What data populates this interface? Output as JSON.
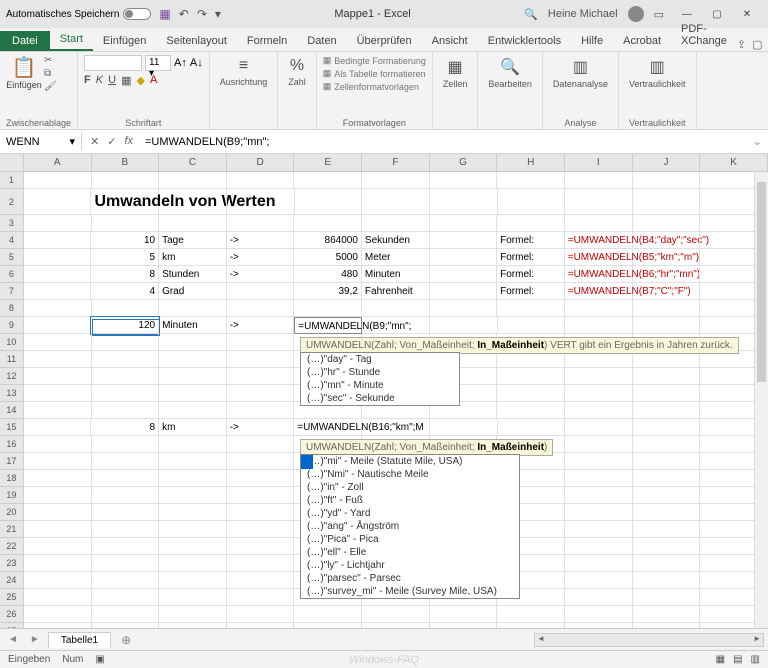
{
  "titlebar": {
    "autosave": "Automatisches Speichern",
    "doc_title": "Mappe1 - Excel",
    "user": "Heine Michael"
  },
  "tabs": {
    "file": "Datei",
    "home": "Start",
    "insert": "Einfügen",
    "pagelayout": "Seitenlayout",
    "formulas": "Formeln",
    "data": "Daten",
    "review": "Überprüfen",
    "view": "Ansicht",
    "developer": "Entwicklertools",
    "help": "Hilfe",
    "acrobat": "Acrobat",
    "pdfx": "PDF-XChange"
  },
  "ribbon": {
    "paste": "Einfügen",
    "clipboard": "Zwischenablage",
    "font": "Schriftart",
    "alignment": "Ausrichtung",
    "number": "Zahl",
    "condfmt": "Bedingte Formatierung",
    "astable": "Als Tabelle formatieren",
    "cellstyles": "Zellenformatvorlagen",
    "styles": "Formatvorlagen",
    "cells": "Zellen",
    "editing": "Bearbeiten",
    "analysis_btn": "Datenanalyse",
    "analysis": "Analyse",
    "sensitivity_btn": "Vertraulichkeit",
    "sensitivity": "Vertraulichkeit"
  },
  "namebox": "WENN",
  "formula_bar": "=UMWANDELN(B9;\"mn\";",
  "sheet": {
    "cols": [
      "A",
      "B",
      "C",
      "D",
      "E",
      "F",
      "G",
      "H",
      "I",
      "J",
      "K"
    ],
    "heading": "Umwandeln von Werten",
    "r4": {
      "b": "10",
      "c": "Tage",
      "d": "->",
      "e": "864000",
      "f": "Sekunden",
      "h": "Formel:",
      "i": "=UMWANDELN(B4;\"day\";\"sec\")"
    },
    "r5": {
      "b": "5",
      "c": "km",
      "d": "->",
      "e": "5000",
      "f": "Meter",
      "h": "Formel:",
      "i": "=UMWANDELN(B5;\"km\";\"m\")"
    },
    "r6": {
      "b": "8",
      "c": "Stunden",
      "d": "->",
      "e": "480",
      "f": "Minuten",
      "h": "Formel:",
      "i": "=UMWANDELN(B6;\"hr\";\"mn\")"
    },
    "r7": {
      "b": "4",
      "c": "Grad",
      "e": "39,2",
      "f": "Fahrenheit",
      "h": "Formel:",
      "i": "=UMWANDELN(B7;\"C\";\"F\")"
    },
    "r9": {
      "b": "120",
      "c": "Minuten",
      "d": "->",
      "e": "=UMWANDELN(B9;\"mn\";"
    },
    "r15": {
      "b": "8",
      "c": "km",
      "d": "->",
      "e": "=UMWANDELN(B16;\"km\";M"
    }
  },
  "tooltip9": {
    "sig": "UMWANDELN(Zahl; Von_Maßeinheit; ",
    "bold": "In_Maßeinheit",
    "rest": ") VERT gibt ein Ergebnis in Jahren zurück."
  },
  "ac9": [
    "(…)\"day\" - Tag",
    "(…)\"hr\" - Stunde",
    "(…)\"mn\" - Minute",
    "(…)\"sec\" - Sekunde"
  ],
  "tooltip15": {
    "sig": "UMWANDELN(Zahl; Von_Maßeinheit; ",
    "bold": "In_Maßeinheit",
    "rest": ")"
  },
  "ac15": [
    "(…)\"mi\" - Meile (Statute Mile, USA)",
    "(…)\"Nmi\" - Nautische Meile",
    "(…)\"in\" - Zoll",
    "(…)\"ft\" - Fuß",
    "(…)\"yd\" - Yard",
    "(…)\"ang\" - Ångström",
    "(…)\"Pica\" - Pica",
    "(…)\"ell\" - Elle",
    "(…)\"ly\" - Lichtjahr",
    "(…)\"parsec\" - Parsec",
    "(…)\"survey_mi\" - Meile (Survey Mile, USA)"
  ],
  "sheettab": "Tabelle1",
  "status": {
    "mode": "Eingeben",
    "num": "Num"
  },
  "watermark": "Windows-FAQ"
}
